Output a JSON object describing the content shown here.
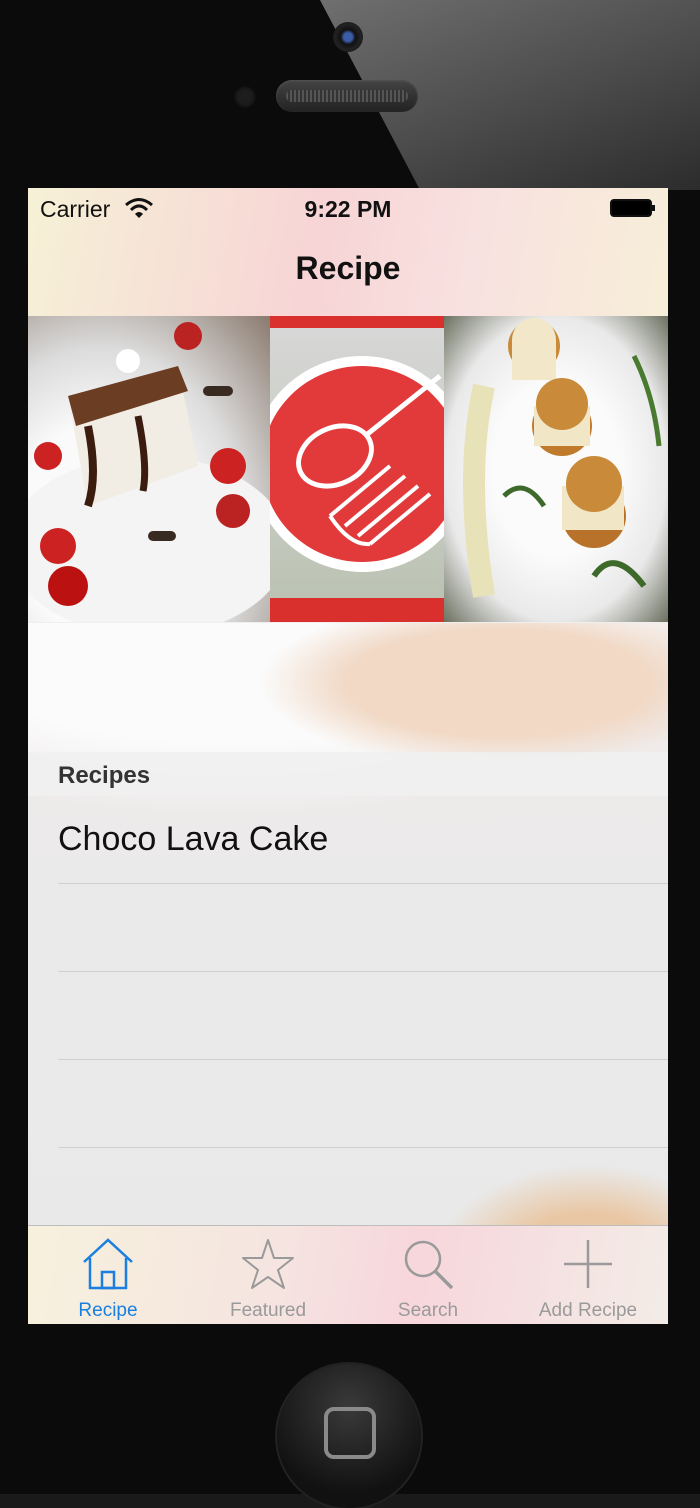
{
  "status_bar": {
    "carrier": "Carrier",
    "time": "9:22 PM"
  },
  "nav": {
    "title": "Recipe"
  },
  "banner": {
    "images": [
      {
        "name": "chocolate-cake-photo"
      },
      {
        "name": "recipe-app-logo"
      },
      {
        "name": "scallops-photo"
      }
    ]
  },
  "section": {
    "title": "Recipes"
  },
  "recipes": [
    {
      "label": "Choco Lava Cake"
    },
    {
      "label": ""
    },
    {
      "label": ""
    },
    {
      "label": ""
    }
  ],
  "tabs": [
    {
      "label": "Recipe",
      "icon": "house-icon",
      "active": true
    },
    {
      "label": "Featured",
      "icon": "star-icon",
      "active": false
    },
    {
      "label": "Search",
      "icon": "magnifier-icon",
      "active": false
    },
    {
      "label": "Add Recipe",
      "icon": "plus-icon",
      "active": false
    }
  ],
  "colors": {
    "accent": "#1a7fe0",
    "inactive": "#9a9a9a",
    "logo_red": "#e23a3a"
  }
}
